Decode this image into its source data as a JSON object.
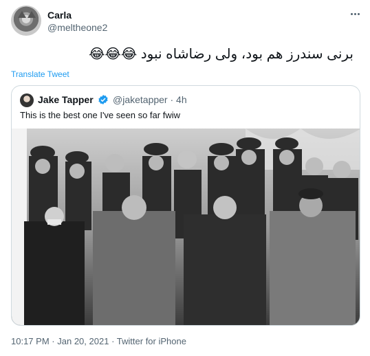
{
  "tweet": {
    "author_name": "Carla",
    "author_handle": "@meltheone2",
    "text": "برنی سندرز هم بود، ولی رضاشاه نبود 😂😂😂",
    "translate_label": "Translate Tweet"
  },
  "quoted_tweet": {
    "author_name": "Jake Tapper",
    "author_handle": "@jaketapper",
    "separator": "·",
    "time_ago": "4h",
    "text": "This is the best one I've seen so far fwiw"
  },
  "footer": {
    "time": "10:17 PM",
    "separator1": "·",
    "date": "Jan 20, 2021",
    "separator2": "·",
    "client": "Twitter for iPhone"
  },
  "colors": {
    "accent": "#1d9bf0",
    "secondary_text": "#536471",
    "border": "#cfd9de"
  },
  "icons": {
    "more": "more-dots-icon",
    "verified": "verified-badge-icon"
  }
}
